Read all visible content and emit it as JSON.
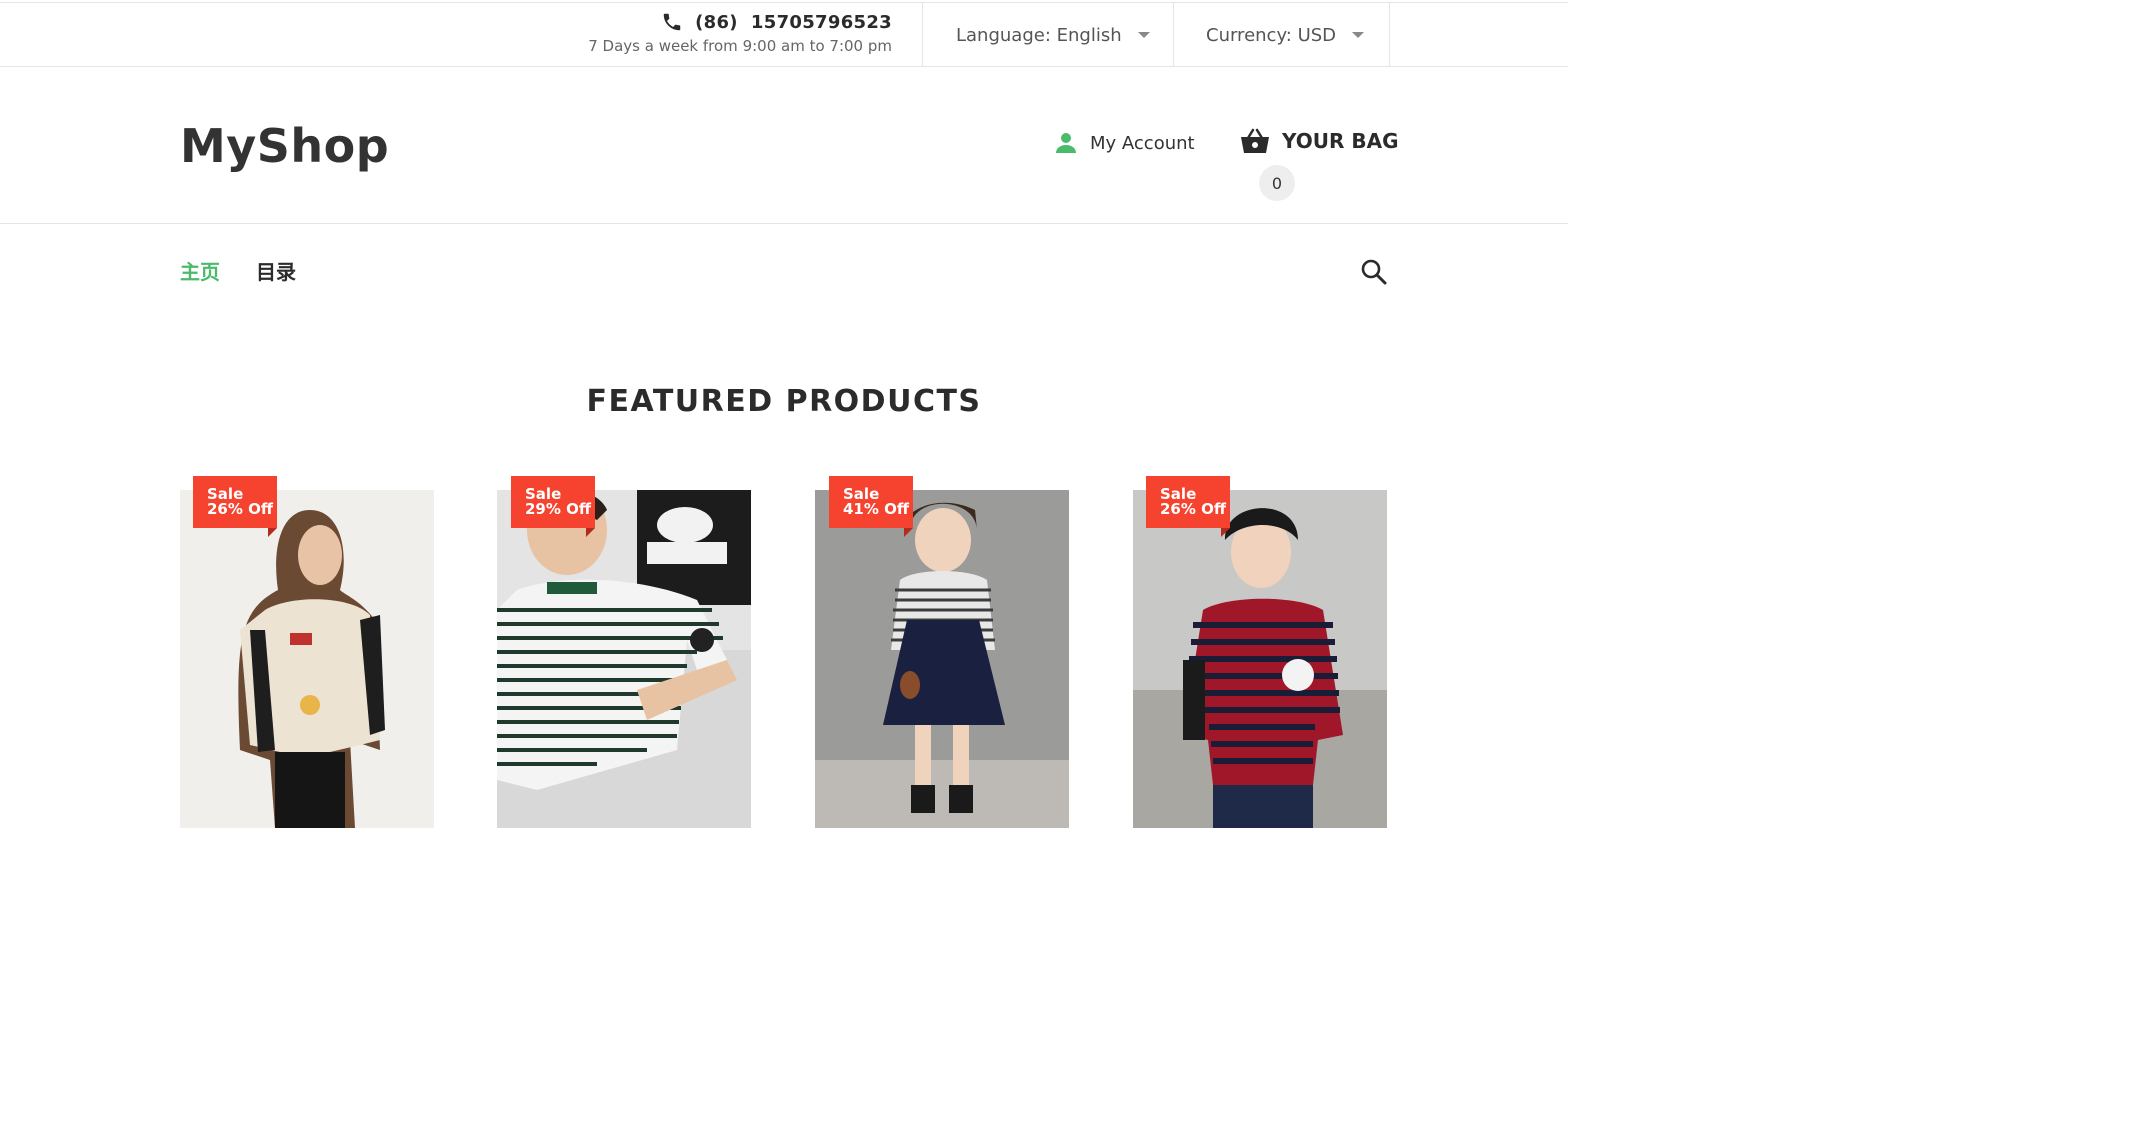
{
  "topbar": {
    "phone": "(86)  15705796523",
    "hours": "7 Days a week from 9:00 am to 7:00 pm",
    "language_label": "Language: English",
    "currency_label": "Currency: USD"
  },
  "header": {
    "logo": "MyShop",
    "account_label": "My Account",
    "bag_label": "YOUR BAG",
    "bag_count": "0"
  },
  "nav": {
    "items": [
      {
        "label": "主页",
        "active": true
      },
      {
        "label": "目录",
        "active": false
      }
    ]
  },
  "featured": {
    "title": "FEATURED PRODUCTS",
    "products": [
      {
        "badge_line1": "Sale",
        "badge_line2": "26% Off",
        "image": "girl-cream-sweater"
      },
      {
        "badge_line1": "Sale",
        "badge_line2": "29% Off",
        "image": "boy-striped-tee"
      },
      {
        "badge_line1": "Sale",
        "badge_line2": "41% Off",
        "image": "girl-navy-dress"
      },
      {
        "badge_line1": "Sale",
        "badge_line2": "26% Off",
        "image": "boy-red-striped-sweater"
      }
    ]
  },
  "colors": {
    "accent_green": "#4cba6b",
    "sale_red": "#f5432f",
    "text_dark": "#2b2b2b"
  },
  "icons": [
    "phone-icon",
    "user-icon",
    "basket-icon",
    "search-icon",
    "chevron-down-icon"
  ]
}
